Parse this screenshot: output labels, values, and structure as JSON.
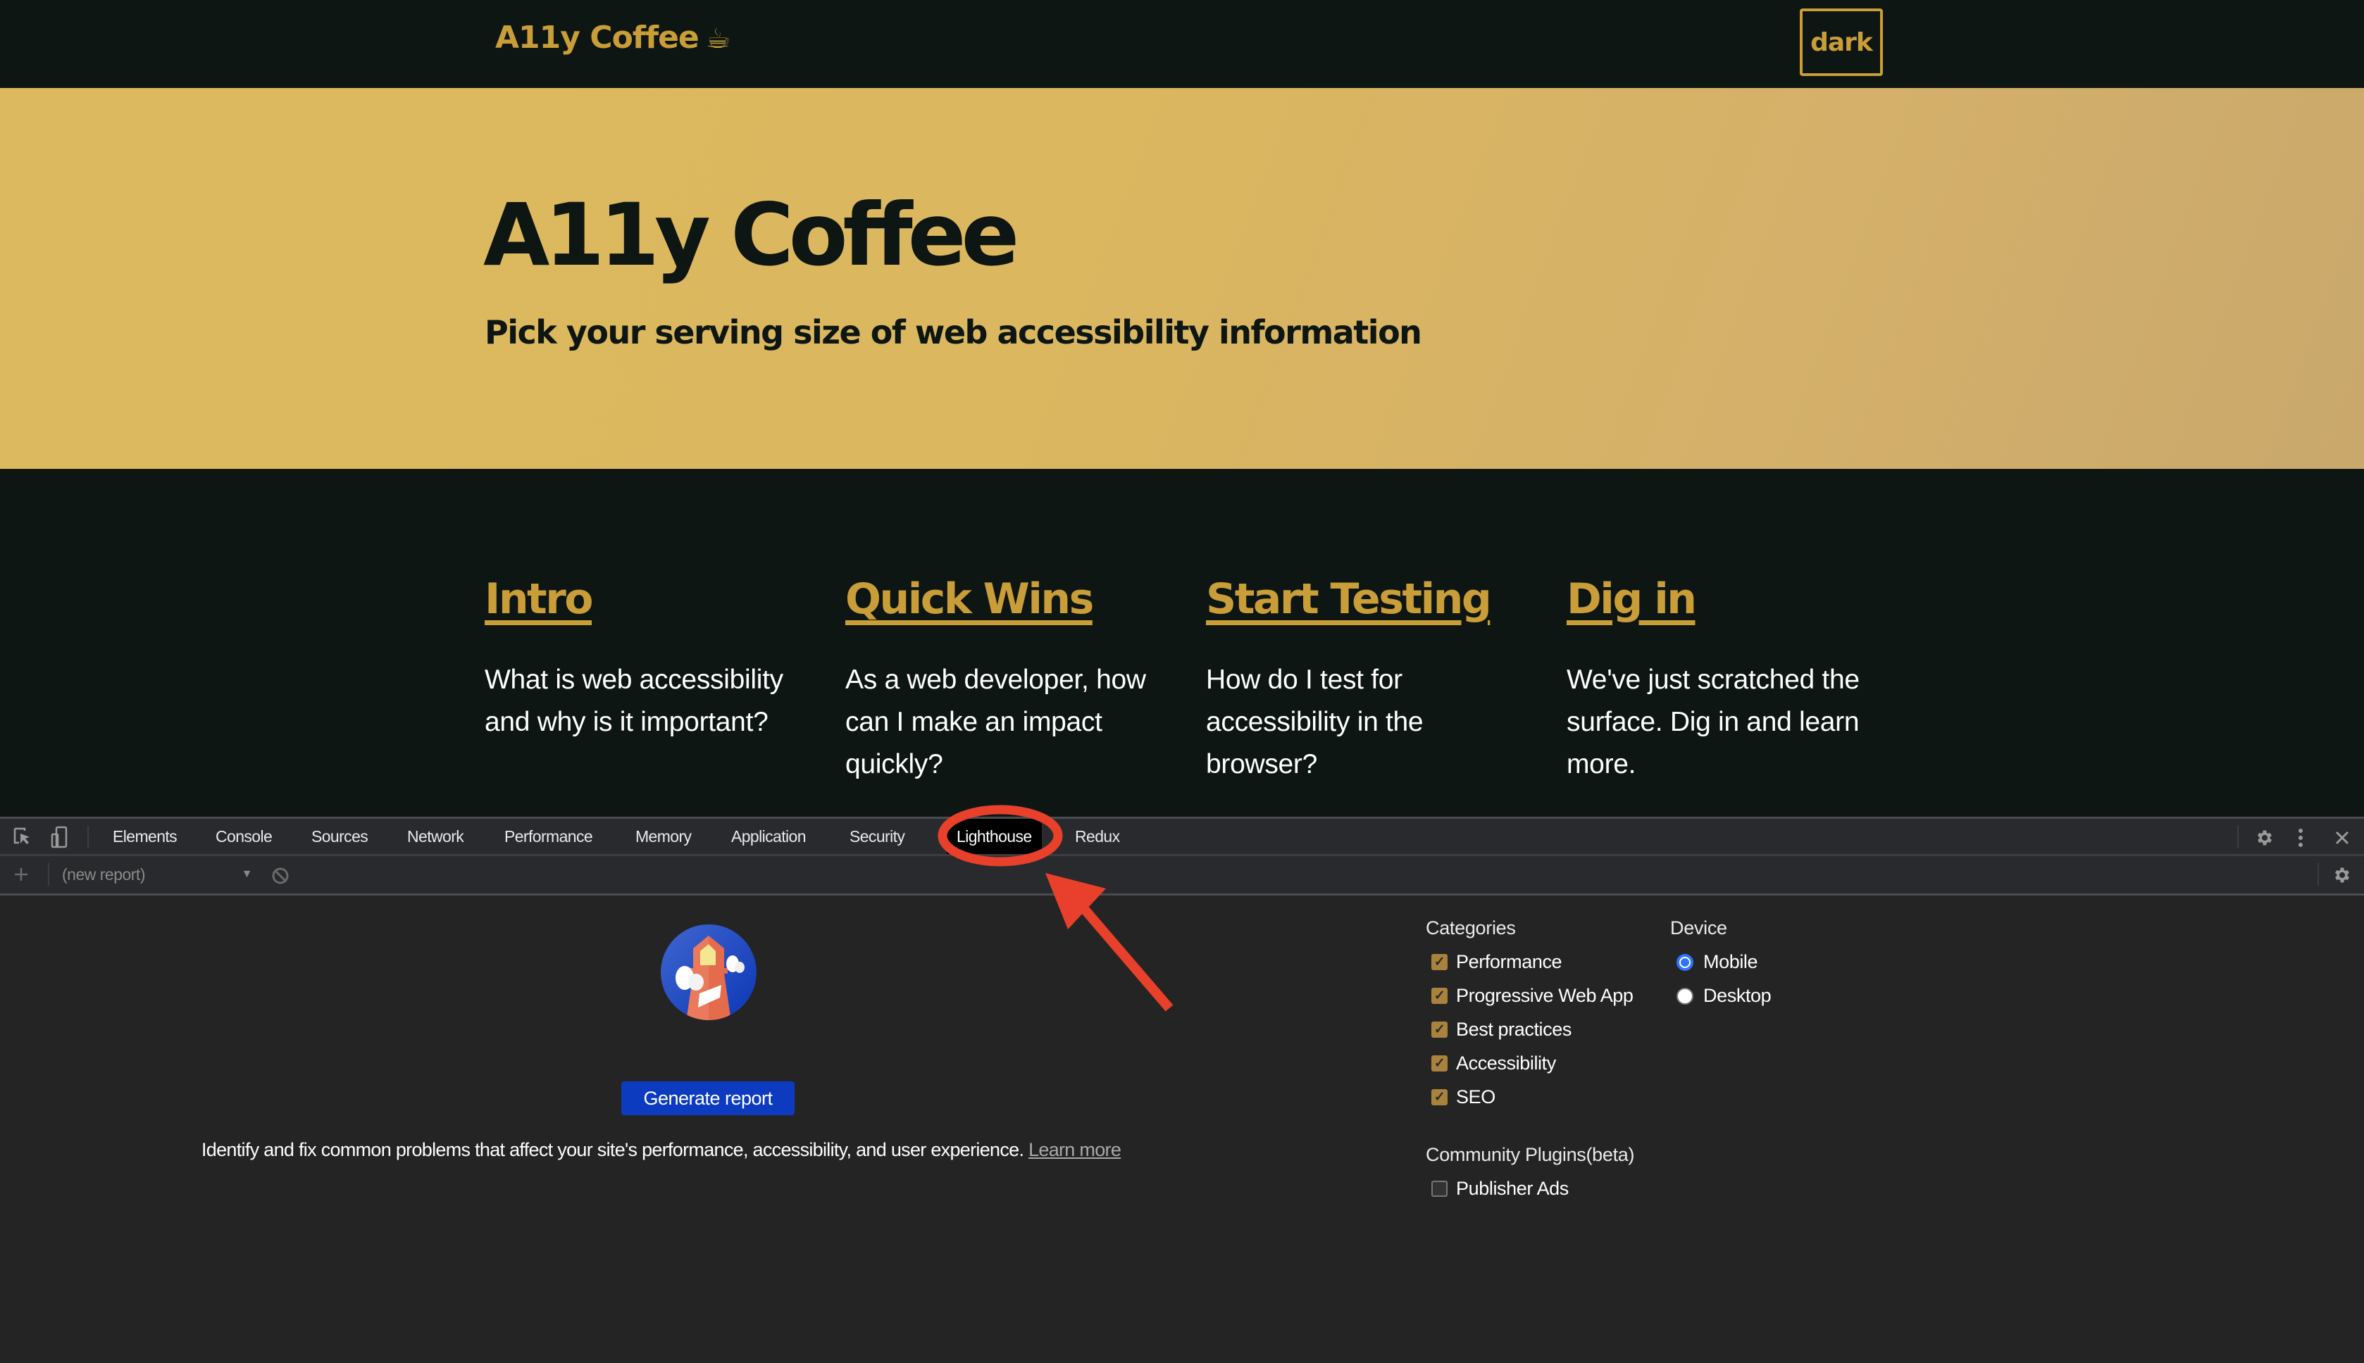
{
  "site": {
    "logo_text": "A11y Coffee",
    "logo_emoji": "☕",
    "theme_toggle_label": "dark",
    "hero_title": "A11y Coffee",
    "hero_subtitle": "Pick your serving size of web accessibility information",
    "cards": [
      {
        "title": "Intro",
        "description": "What is web accessibility and why is it important?"
      },
      {
        "title": "Quick Wins",
        "description": "As a web developer, how can I make an impact quickly?"
      },
      {
        "title": "Start Testing",
        "description": "How do I test for accessibility in the browser?"
      },
      {
        "title": "Dig in",
        "description": "We've just scratched the surface. Dig in and learn more."
      }
    ]
  },
  "devtools": {
    "tabs": [
      {
        "label": "Elements",
        "active": false
      },
      {
        "label": "Console",
        "active": false
      },
      {
        "label": "Sources",
        "active": false
      },
      {
        "label": "Network",
        "active": false
      },
      {
        "label": "Performance",
        "active": false
      },
      {
        "label": "Memory",
        "active": false
      },
      {
        "label": "Application",
        "active": false
      },
      {
        "label": "Security",
        "active": false
      },
      {
        "label": "Lighthouse",
        "active": true
      },
      {
        "label": "Redux",
        "active": false
      }
    ],
    "icons": {
      "inspect": "inspect-element-icon",
      "device": "device-toolbar-icon",
      "settings": "gear-icon",
      "more": "kebab-menu-icon",
      "close": "close-icon",
      "add": "plus-icon",
      "clear": "block-icon"
    },
    "toolbar": {
      "report_select_value": "(new report)"
    },
    "lighthouse": {
      "generate_button_label": "Generate report",
      "description": "Identify and fix common problems that affect your site's performance, accessibility, and user experience.",
      "learn_more_label": "Learn more",
      "categories_heading": "Categories",
      "categories": [
        {
          "label": "Performance",
          "checked": true
        },
        {
          "label": "Progressive Web App",
          "checked": true
        },
        {
          "label": "Best practices",
          "checked": true
        },
        {
          "label": "Accessibility",
          "checked": true
        },
        {
          "label": "SEO",
          "checked": true
        }
      ],
      "device_heading": "Device",
      "devices": [
        {
          "label": "Mobile",
          "selected": true
        },
        {
          "label": "Desktop",
          "selected": false
        }
      ],
      "plugins_heading": "Community Plugins(beta)",
      "plugins": [
        {
          "label": "Publisher Ads",
          "checked": false
        }
      ]
    }
  },
  "colors": {
    "site_bg": "#0d1613",
    "brand_gold": "#c99d38",
    "hero_gold": "#dcb85e",
    "devtools_bg": "#242424",
    "generate_button": "#0d3bbf",
    "annotation_red": "#e8402a",
    "checkbox_on": "#a9823d",
    "radio_on": "#2f73ff"
  },
  "annotation": {
    "highlight_target": "Lighthouse tab",
    "shape": "red circle with arrow"
  }
}
